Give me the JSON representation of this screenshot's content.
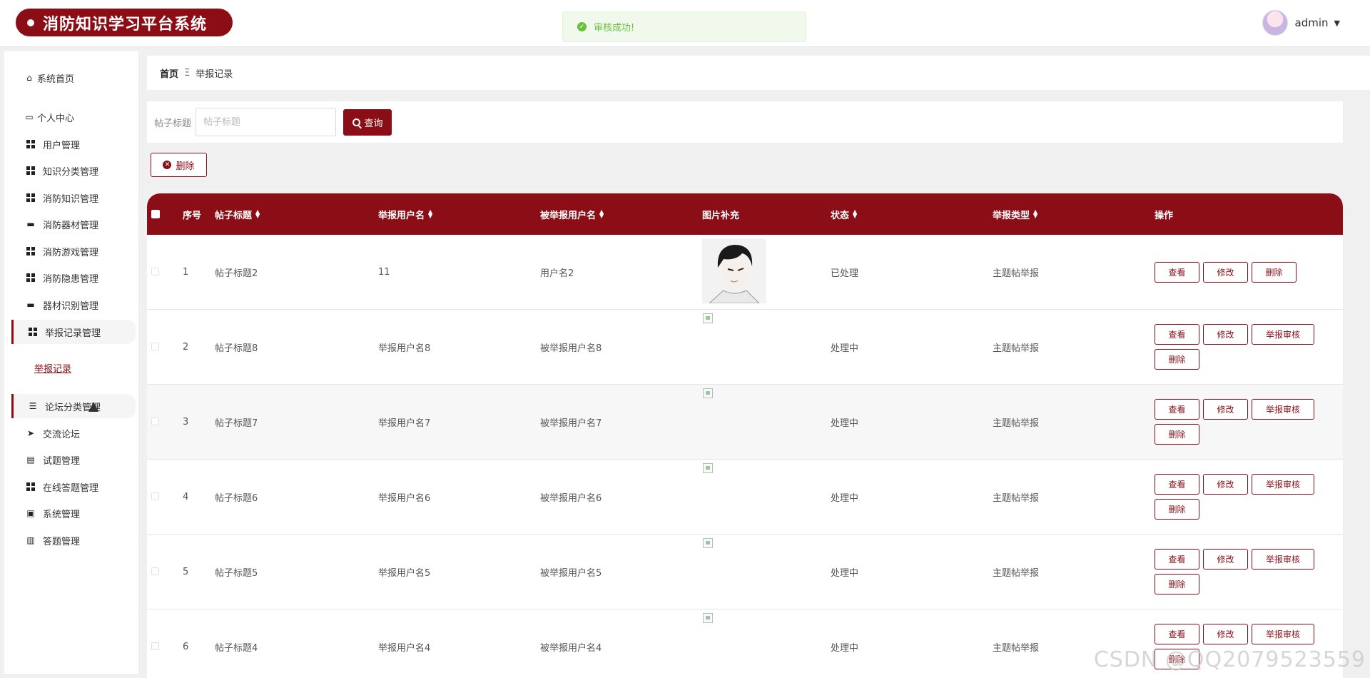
{
  "app": {
    "title": "消防知识学习平台系统"
  },
  "toast": {
    "text": "审核成功!"
  },
  "user": {
    "name": "admin"
  },
  "sidebar": {
    "items": [
      {
        "label": "系统首页",
        "icon": "home-icon"
      },
      {
        "label": "个人中心",
        "icon": "profile-icon"
      },
      {
        "label": "用户管理",
        "icon": "grid-icon"
      },
      {
        "label": "知识分类管理",
        "icon": "grid-icon"
      },
      {
        "label": "消防知识管理",
        "icon": "grid-icon"
      },
      {
        "label": "消防器材管理",
        "icon": "monitor-icon"
      },
      {
        "label": "消防游戏管理",
        "icon": "grid-icon"
      },
      {
        "label": "消防隐患管理",
        "icon": "grid-icon"
      },
      {
        "label": "器材识别管理",
        "icon": "printer-icon"
      },
      {
        "label": "举报记录管理",
        "icon": "grid-icon"
      },
      {
        "label": "论坛分类管理",
        "icon": "list-icon"
      },
      {
        "label": "交流论坛",
        "icon": "send-icon"
      },
      {
        "label": "试题管理",
        "icon": "clipboard-icon"
      },
      {
        "label": "在线答题管理",
        "icon": "grid-icon"
      },
      {
        "label": "系统管理",
        "icon": "clipboard-check-icon"
      },
      {
        "label": "答题管理",
        "icon": "book-icon"
      }
    ],
    "sub_link": "举报记录"
  },
  "breadcrumb": {
    "home": "首页",
    "separator": "Ξ",
    "current": "举报记录"
  },
  "search": {
    "label": "帖子标题",
    "placeholder": "帖子标题",
    "value": "",
    "button": "查询"
  },
  "toolbar": {
    "delete_label": "删除"
  },
  "table": {
    "headers": [
      "序号",
      "帖子标题",
      "举报用户名",
      "被举报用户名",
      "图片补充",
      "状态",
      "举报类型",
      "操作"
    ],
    "rows": [
      {
        "index": "1",
        "title": "帖子标题2",
        "reporter": "11",
        "reported": "用户名2",
        "image": "photo",
        "status": "已处理",
        "type": "主题帖举报"
      },
      {
        "index": "2",
        "title": "帖子标题8",
        "reporter": "举报用户名8",
        "reported": "被举报用户名8",
        "image": "broken",
        "status": "处理中",
        "type": "主题帖举报"
      },
      {
        "index": "3",
        "title": "帖子标题7",
        "reporter": "举报用户名7",
        "reported": "被举报用户名7",
        "image": "broken",
        "status": "处理中",
        "type": "主题帖举报"
      },
      {
        "index": "4",
        "title": "帖子标题6",
        "reporter": "举报用户名6",
        "reported": "被举报用户名6",
        "image": "broken",
        "status": "处理中",
        "type": "主题帖举报"
      },
      {
        "index": "5",
        "title": "帖子标题5",
        "reporter": "举报用户名5",
        "reported": "被举报用户名5",
        "image": "broken",
        "status": "处理中",
        "type": "主题帖举报"
      },
      {
        "index": "6",
        "title": "帖子标题4",
        "reporter": "举报用户名4",
        "reported": "被举报用户名4",
        "image": "broken",
        "status": "处理中",
        "type": "主题帖举报"
      }
    ],
    "actions": {
      "view": "查看",
      "edit": "修改",
      "audit": "举报审核",
      "delete": "删除"
    }
  },
  "watermark": "CSDN @QQ2079523559",
  "colors": {
    "primary": "#8b0e17",
    "success": "#67c23a"
  }
}
